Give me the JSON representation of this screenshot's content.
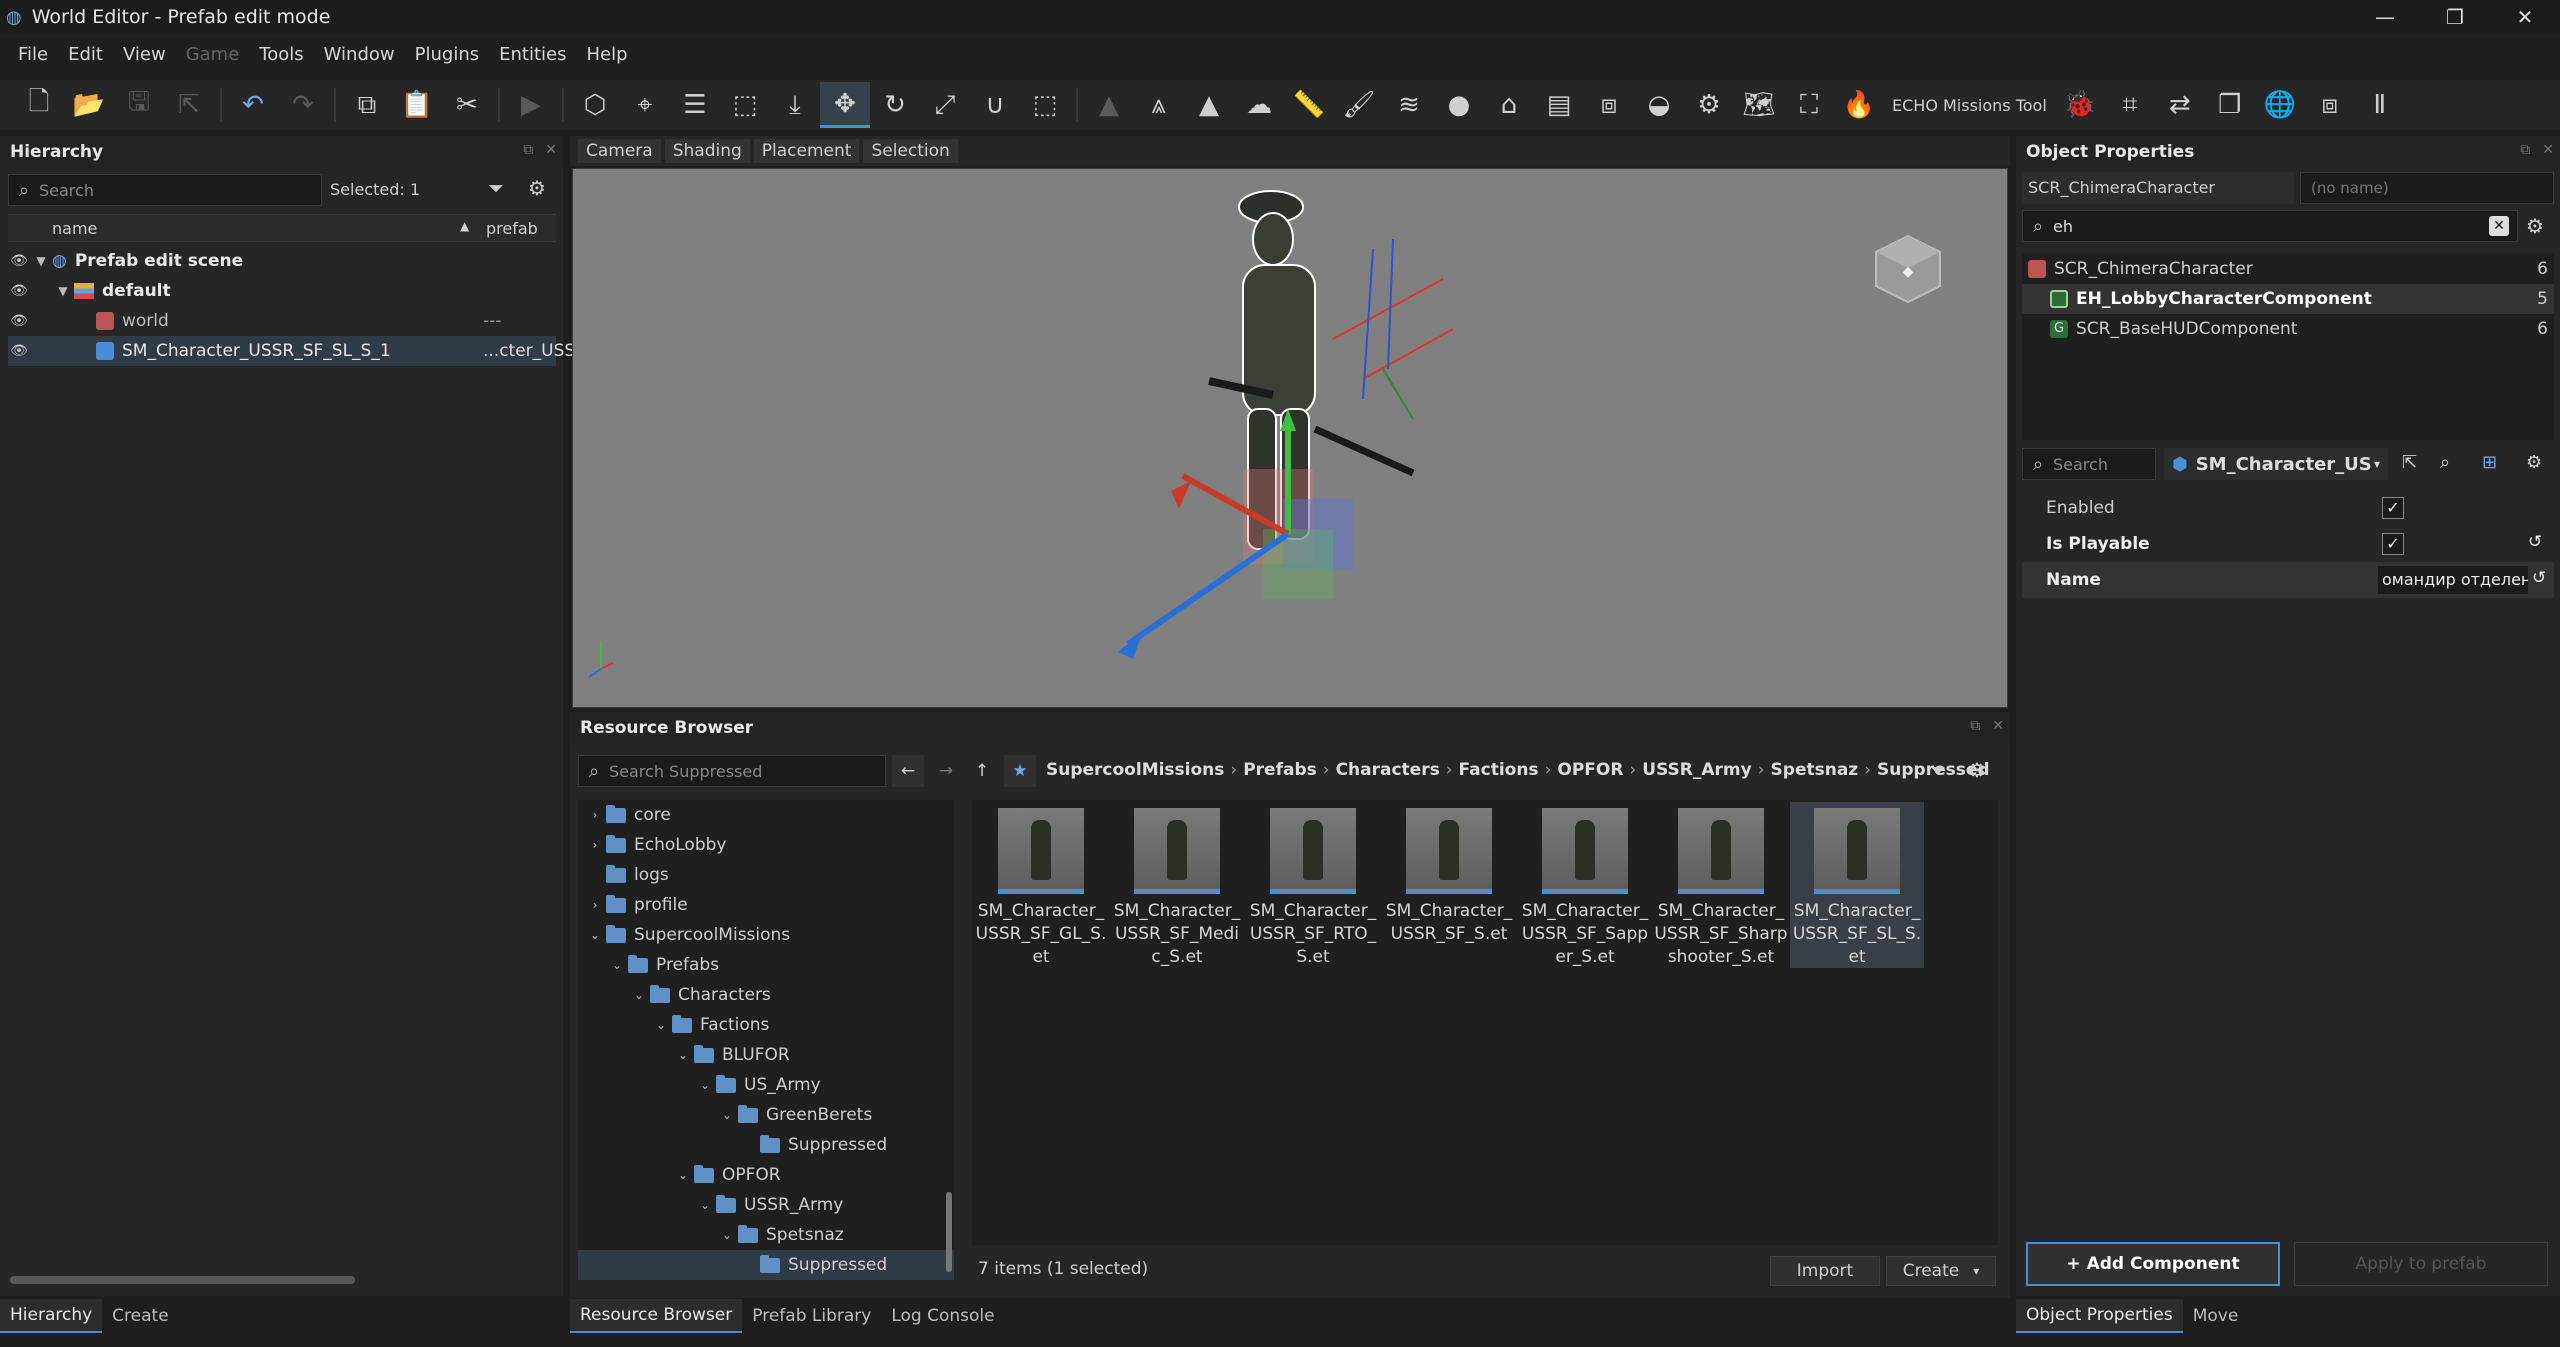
{
  "titlebar": {
    "title": "World Editor - Prefab edit mode",
    "minimize": "—",
    "maximize": "❐",
    "close": "✕"
  },
  "menu": [
    "File",
    "Edit",
    "View",
    "Game",
    "Tools",
    "Window",
    "Plugins",
    "Entities",
    "Help"
  ],
  "toolbar": {
    "echo_tool": "ECHO Missions Tool"
  },
  "hierarchy": {
    "title": "Hierarchy",
    "search_placeholder": "Search",
    "selected": "Selected: 1",
    "col_name": "name",
    "col_prefab": "prefab",
    "rows": [
      {
        "name": "Prefab edit scene",
        "prefab": ""
      },
      {
        "name": "default",
        "prefab": ""
      },
      {
        "name": "world",
        "prefab": "---"
      },
      {
        "name": "SM_Character_USSR_SF_SL_S_1",
        "prefab": "...cter_USS"
      }
    ],
    "tabs": [
      "Hierarchy",
      "Create"
    ]
  },
  "viewport": {
    "tabs": [
      "Camera",
      "Shading",
      "Placement",
      "Selection"
    ]
  },
  "resource_browser": {
    "title": "Resource Browser",
    "search_placeholder": "Search Suppressed",
    "breadcrumb": [
      "SupercoolMissions",
      "Prefabs",
      "Characters",
      "Factions",
      "OPFOR",
      "USSR_Army",
      "Spetsnaz",
      "Suppressed"
    ],
    "tree": [
      {
        "label": "core",
        "level": 0,
        "arrow": "›"
      },
      {
        "label": "EchoLobby",
        "level": 0,
        "arrow": "›"
      },
      {
        "label": "logs",
        "level": 0,
        "arrow": ""
      },
      {
        "label": "profile",
        "level": 0,
        "arrow": "›"
      },
      {
        "label": "SupercoolMissions",
        "level": 0,
        "arrow": "⌄"
      },
      {
        "label": "Prefabs",
        "level": 1,
        "arrow": "⌄"
      },
      {
        "label": "Characters",
        "level": 2,
        "arrow": "⌄"
      },
      {
        "label": "Factions",
        "level": 3,
        "arrow": "⌄"
      },
      {
        "label": "BLUFOR",
        "level": 4,
        "arrow": "⌄"
      },
      {
        "label": "US_Army",
        "level": 5,
        "arrow": "⌄"
      },
      {
        "label": "GreenBerets",
        "level": 6,
        "arrow": "⌄"
      },
      {
        "label": "Suppressed",
        "level": 7,
        "arrow": ""
      },
      {
        "label": "OPFOR",
        "level": 4,
        "arrow": "⌄"
      },
      {
        "label": "USSR_Army",
        "level": 5,
        "arrow": "⌄"
      },
      {
        "label": "Spetsnaz",
        "level": 6,
        "arrow": "⌄"
      },
      {
        "label": "Suppressed",
        "level": 7,
        "arrow": ""
      }
    ],
    "assets": [
      [
        "SM_Character_",
        "USSR_SF_GL_S.",
        "et"
      ],
      [
        "SM_Character_",
        "USSR_SF_Medi",
        "c_S.et"
      ],
      [
        "SM_Character_",
        "USSR_SF_RTO_",
        "S.et"
      ],
      [
        "SM_Character_",
        "USSR_SF_S.et",
        ""
      ],
      [
        "SM_Character_",
        "USSR_SF_Sapp",
        "er_S.et"
      ],
      [
        "SM_Character_",
        "USSR_SF_Sharp",
        "shooter_S.et"
      ],
      [
        "SM_Character_",
        "USSR_SF_SL_S.",
        "et"
      ]
    ],
    "status": "7 items (1 selected)",
    "import": "Import",
    "create": "Create",
    "tabs": [
      "Resource Browser",
      "Prefab Library",
      "Log Console"
    ]
  },
  "object_properties": {
    "title": "Object Properties",
    "class_name": "SCR_ChimeraCharacter",
    "no_name": "(no name)",
    "filter": "eh",
    "components": [
      {
        "name": "SCR_ChimeraCharacter",
        "count": "6"
      },
      {
        "name": "EH_LobbyCharacterComponent",
        "count": "5"
      },
      {
        "name": "SCR_BaseHUDComponent",
        "count": "6"
      }
    ],
    "search_placeholder": "Search",
    "mesh_select": "SM_Character_US",
    "props": [
      {
        "label": "Enabled",
        "value": "✓"
      },
      {
        "label": "Is Playable",
        "value": "✓"
      },
      {
        "label": "Name",
        "value": "омандир отделения"
      }
    ],
    "add_component": "+ Add Component",
    "apply_to_prefab": "Apply to prefab",
    "tabs": [
      "Object Properties",
      "Move"
    ]
  }
}
